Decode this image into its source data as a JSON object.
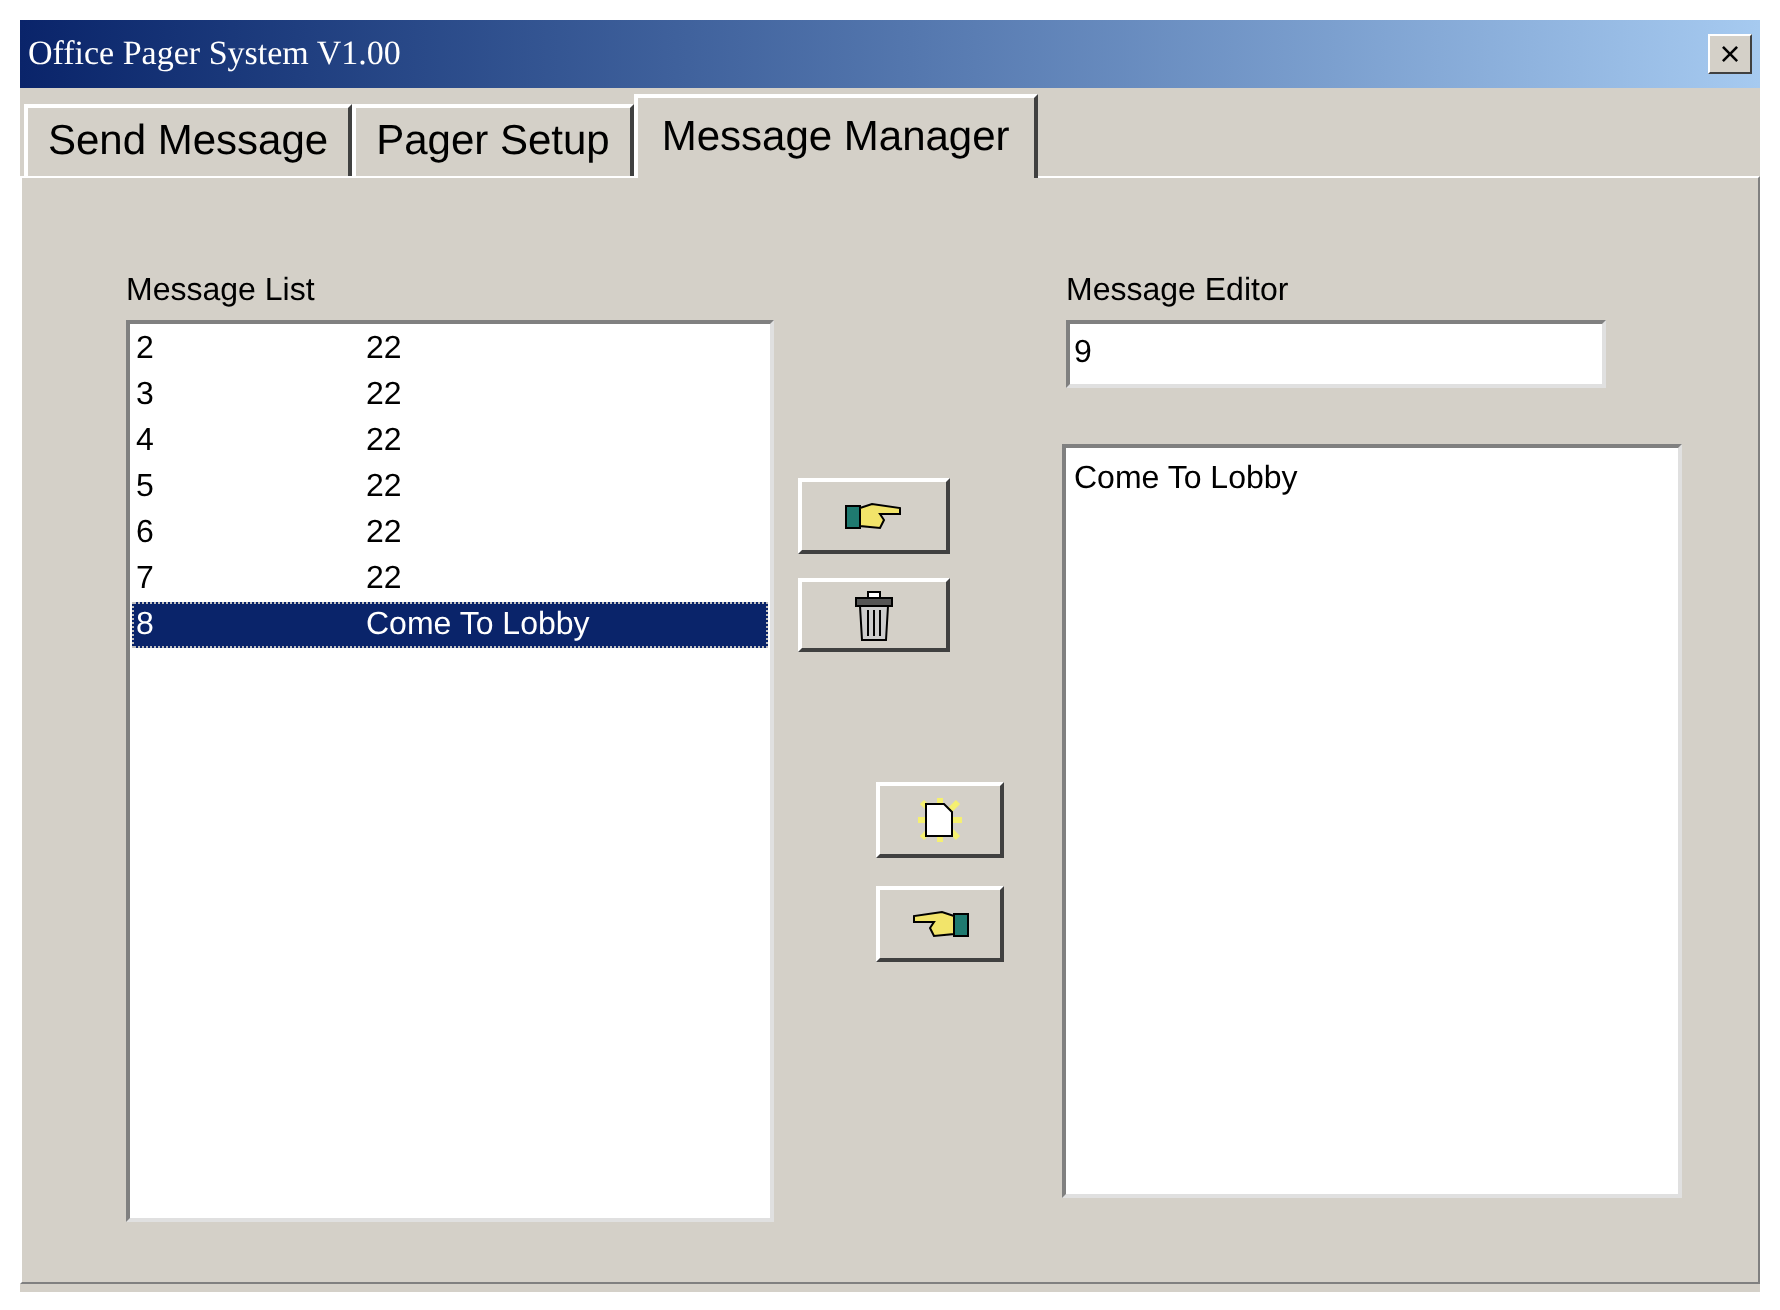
{
  "window": {
    "title": "Office Pager System V1.00",
    "close": "×"
  },
  "tabs": [
    {
      "label": "Send Message",
      "selected": false
    },
    {
      "label": "Pager Setup",
      "selected": false
    },
    {
      "label": "Message Manager",
      "selected": true
    }
  ],
  "message_list": {
    "label": "Message List",
    "rows": [
      {
        "number": "2",
        "text": "22",
        "selected": false
      },
      {
        "number": "3",
        "text": "22",
        "selected": false
      },
      {
        "number": "4",
        "text": "22",
        "selected": false
      },
      {
        "number": "5",
        "text": "22",
        "selected": false
      },
      {
        "number": "6",
        "text": "22",
        "selected": false
      },
      {
        "number": "7",
        "text": "22",
        "selected": false
      },
      {
        "number": "8",
        "text": "Come To Lobby",
        "selected": true
      }
    ]
  },
  "message_editor": {
    "label": "Message Editor",
    "number": "9",
    "text": "Come To Lobby"
  }
}
